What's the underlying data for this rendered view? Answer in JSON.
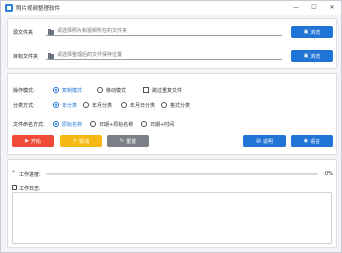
{
  "window": {
    "title": "照片视频整理软件",
    "controls": {
      "minimize": "—",
      "maximize": "☐",
      "close": "✕"
    }
  },
  "source": {
    "label": "源文件夹",
    "placeholder": "请选择照片和视频所在的文件夹",
    "browse": "浏览"
  },
  "target": {
    "label": "目标文件夹",
    "placeholder": "请选择整理后的文件保存位置",
    "browse": "浏览"
  },
  "options": {
    "operation": {
      "label": "操作模式:",
      "choices": [
        "复制模式",
        "移动模式"
      ],
      "selected": "复制模式",
      "skip_duplicates": "跳过重复文件",
      "skip_checked": false
    },
    "classify": {
      "label": "分类方式:",
      "choices": [
        "年分类",
        "年月分类",
        "年月日分类",
        "格式分类"
      ],
      "selected": "年分类"
    },
    "naming": {
      "label": "文件命名方式:",
      "choices": [
        "原始名称",
        "日期+原始名称",
        "日期+时间"
      ],
      "selected": "原始名称"
    }
  },
  "actions": {
    "start": "开始",
    "cancel": "取消",
    "reset": "重置",
    "help": "说明",
    "language": "语言"
  },
  "progress": {
    "label": "工作进度:",
    "value": 0,
    "text": "0%"
  },
  "log": {
    "label": "工作日志:",
    "content": ""
  },
  "colors": {
    "primary": "#1f74d6",
    "start": "#f04b38",
    "cancel": "#f6b812",
    "reset": "#7b7f86"
  }
}
